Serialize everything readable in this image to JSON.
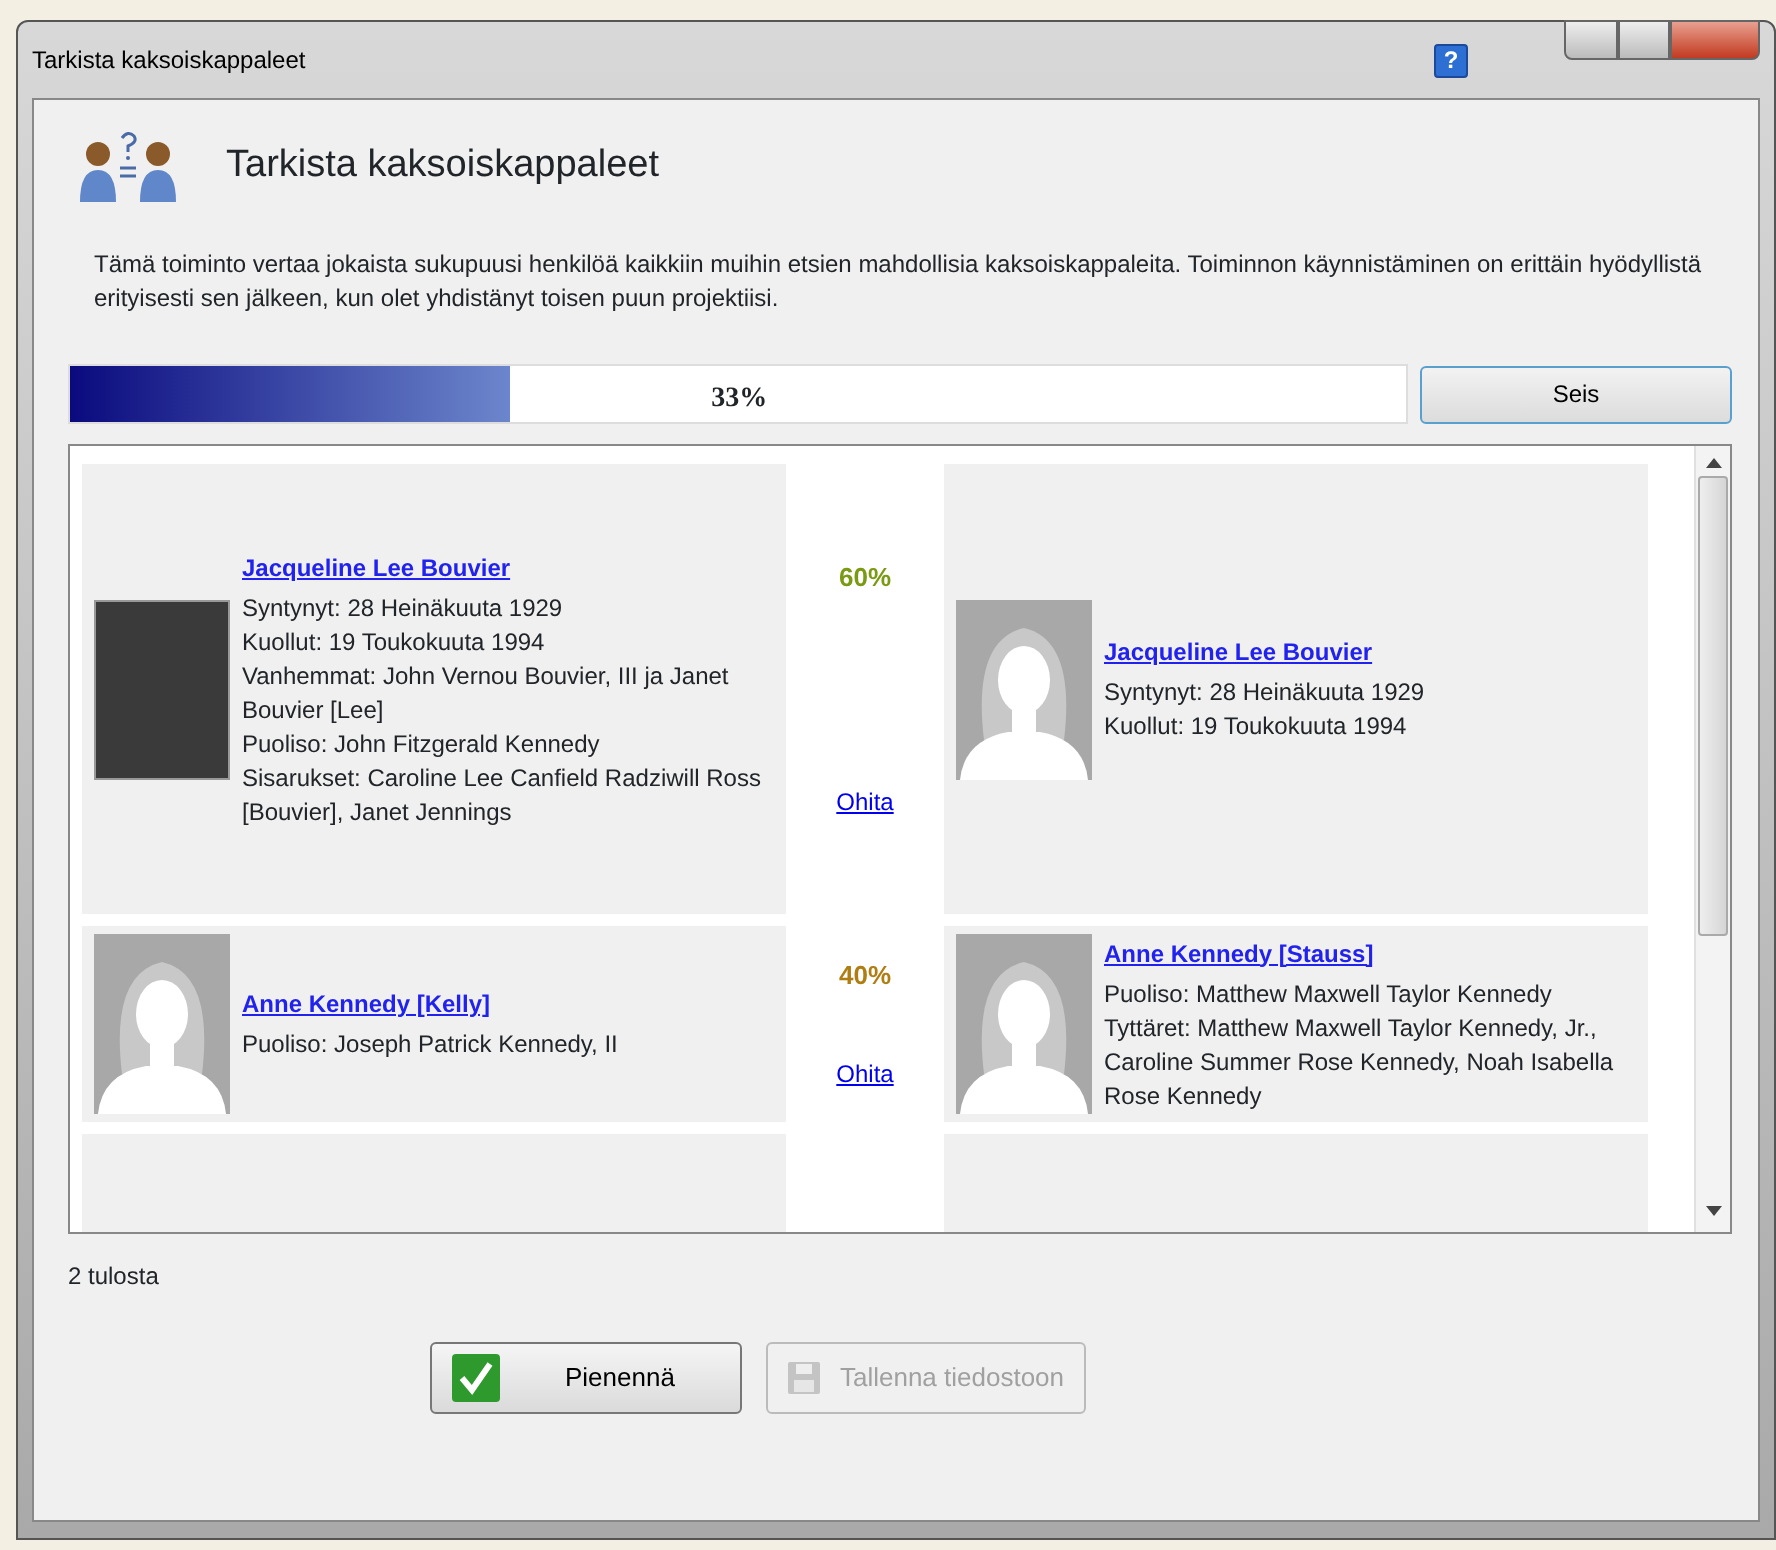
{
  "window": {
    "title": "Tarkista kaksoiskappaleet",
    "help": "?"
  },
  "header": {
    "title": "Tarkista kaksoiskappaleet"
  },
  "description": "Tämä toiminto vertaa jokaista sukupuusi henkilöä kaikkiin muihin etsien mahdollisia kaksoiskappaleita. Toiminnon käynnistäminen on erittäin hyödyllistä erityisesti sen jälkeen, kun olet yhdistänyt toisen puun projektiisi.",
  "progress": {
    "level": 0.33,
    "reading": "33%"
  },
  "stop_button": "Seis",
  "matches": [
    {
      "left": {
        "kind": "photo",
        "name": "Jacqueline Lee Bouvier",
        "details": [
          "Syntynyt: 28 Heinäkuuta 1929",
          "Kuollut: 19 Toukokuuta 1994",
          "Vanhemmat: John Vernou Bouvier, III ja Janet Bouvier [Lee]",
          "Puoliso: John Fitzgerald Kennedy",
          "Sisarukset: Caroline Lee Canfield Radziwill Ross [Bouvier], Janet Jennings"
        ]
      },
      "score": "60%",
      "color": "#7a9a12",
      "skip": "Ohita",
      "right": {
        "kind": "silhouette",
        "name": "Jacqueline Lee Bouvier",
        "details": [
          "Syntynyt: 28 Heinäkuuta 1929",
          "Kuollut: 19 Toukokuuta 1994"
        ]
      }
    },
    {
      "left": {
        "kind": "silhouette",
        "name": "Anne Kennedy [Kelly]",
        "details": [
          "Puoliso: Joseph Patrick Kennedy, II"
        ]
      },
      "score": "40%",
      "color": "#b07d12",
      "skip": "Ohita",
      "right": {
        "kind": "silhouette",
        "name": "Anne Kennedy [Stauss]",
        "details": [
          "Puoliso: Matthew Maxwell Taylor Kennedy",
          "Tyttäret: Matthew Maxwell Taylor Kennedy, Jr., Caroline Summer Rose Kennedy, Noah Isabella Rose Kennedy"
        ]
      }
    }
  ],
  "result_count": "2 tulosta",
  "buttons": [
    {
      "label": "Pienennä",
      "kind": "confirm",
      "disabled": false
    },
    {
      "label": "Tallenna tiedostoon",
      "kind": "save",
      "disabled": true
    }
  ]
}
